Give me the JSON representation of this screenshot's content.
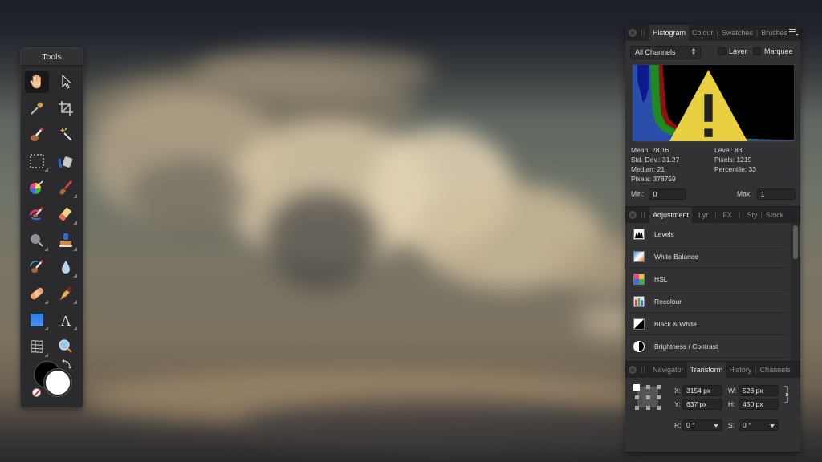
{
  "tools_panel": {
    "title": "Tools",
    "tools": [
      {
        "name": "view-tool",
        "icon": "hand-icon",
        "active": true,
        "has_flyout": false
      },
      {
        "name": "move-tool",
        "icon": "arrow-cursor-icon",
        "active": false,
        "has_flyout": false
      },
      {
        "name": "color-picker-tool",
        "icon": "eyedropper-icon",
        "active": false,
        "has_flyout": false
      },
      {
        "name": "crop-tool",
        "icon": "crop-icon",
        "active": false,
        "has_flyout": false
      },
      {
        "name": "selection-brush-tool",
        "icon": "selection-brush-icon",
        "active": false,
        "has_flyout": false
      },
      {
        "name": "flood-select-tool",
        "icon": "magic-wand-icon",
        "active": false,
        "has_flyout": false
      },
      {
        "name": "marquee-tool",
        "icon": "marquee-icon",
        "active": false,
        "has_flyout": true
      },
      {
        "name": "flood-fill-tool",
        "icon": "paint-bucket-icon",
        "active": false,
        "has_flyout": false
      },
      {
        "name": "colour-replacement-tool",
        "icon": "colour-wheel-brush-icon",
        "active": false,
        "has_flyout": false
      },
      {
        "name": "paint-brush-tool",
        "icon": "paint-brush-icon",
        "active": false,
        "has_flyout": true
      },
      {
        "name": "pixel-tool",
        "icon": "colour-brush-icon",
        "active": false,
        "has_flyout": false
      },
      {
        "name": "erase-brush-tool",
        "icon": "eraser-icon",
        "active": false,
        "has_flyout": true
      },
      {
        "name": "dodge-tool",
        "icon": "dodge-icon",
        "active": false,
        "has_flyout": true
      },
      {
        "name": "clone-tool",
        "icon": "stamp-icon",
        "active": false,
        "has_flyout": true
      },
      {
        "name": "smudge-tool",
        "icon": "smudge-brush-icon",
        "active": false,
        "has_flyout": false
      },
      {
        "name": "blur-tool",
        "icon": "water-drop-icon",
        "active": false,
        "has_flyout": true
      },
      {
        "name": "healing-tool",
        "icon": "bandage-icon",
        "active": false,
        "has_flyout": true
      },
      {
        "name": "pen-tool",
        "icon": "pen-nib-icon",
        "active": false,
        "has_flyout": true
      },
      {
        "name": "rectangle-tool",
        "icon": "rectangle-shape-icon",
        "active": false,
        "has_flyout": true
      },
      {
        "name": "text-tool",
        "icon": "text-a-icon",
        "active": false,
        "has_flyout": true
      },
      {
        "name": "mesh-warp-tool",
        "icon": "mesh-warp-icon",
        "active": false,
        "has_flyout": true
      },
      {
        "name": "zoom-tool",
        "icon": "magnifier-icon",
        "active": false,
        "has_flyout": false
      }
    ],
    "colors": {
      "primary": "#000000",
      "secondary": "#ffffff"
    }
  },
  "histogram_panel": {
    "tabs": [
      {
        "label": "Histogram",
        "active": true
      },
      {
        "label": "Colour",
        "active": false
      },
      {
        "label": "Swatches",
        "active": false
      },
      {
        "label": "Brushes",
        "active": false
      }
    ],
    "channel_select": "All Channels",
    "checkbox_layer": {
      "label": "Layer",
      "checked": false
    },
    "checkbox_marquee": {
      "label": "Marquee",
      "checked": false
    },
    "warning": "warning-triangle-icon",
    "stats": {
      "mean": "Mean: 28.16",
      "std_dev": "Std. Dev.: 31.27",
      "median": "Median: 21",
      "pixels_total": "Pixels: 378759",
      "level": "Level: 83",
      "pixels_level": "Pixels: 1219",
      "percentile": "Percentile: 33"
    },
    "min_label": "Min:",
    "min_value": "0",
    "max_label": "Max:",
    "max_value": "1",
    "colors": {
      "blue": "#2a4aa8",
      "navy": "#0b1a8a",
      "green": "#1f8a1f",
      "red": "#8a1010"
    }
  },
  "adjustment_panel": {
    "tabs": [
      {
        "label": "Adjustment",
        "active": true
      },
      {
        "label": "Lyr",
        "active": false
      },
      {
        "label": "FX",
        "active": false
      },
      {
        "label": "Sty",
        "active": false
      },
      {
        "label": "Stock",
        "active": false
      }
    ],
    "items": [
      {
        "label": "Levels",
        "icon": "levels-icon"
      },
      {
        "label": "White Balance",
        "icon": "white-balance-icon"
      },
      {
        "label": "HSL",
        "icon": "hsl-icon"
      },
      {
        "label": "Recolour",
        "icon": "recolour-icon"
      },
      {
        "label": "Black & White",
        "icon": "black-white-icon"
      },
      {
        "label": "Brightness / Contrast",
        "icon": "brightness-contrast-icon"
      }
    ]
  },
  "transform_panel": {
    "tabs": [
      {
        "label": "Navigator",
        "active": false
      },
      {
        "label": "Transform",
        "active": true
      },
      {
        "label": "History",
        "active": false
      },
      {
        "label": "Channels",
        "active": false
      }
    ],
    "x_label": "X:",
    "x_value": "3154 px",
    "y_label": "Y:",
    "y_value": "637 px",
    "w_label": "W:",
    "w_value": "528 px",
    "h_label": "H:",
    "h_value": "450 px",
    "r_label": "R:",
    "r_value": "0 °",
    "s_label": "S:",
    "s_value": "0 °"
  }
}
